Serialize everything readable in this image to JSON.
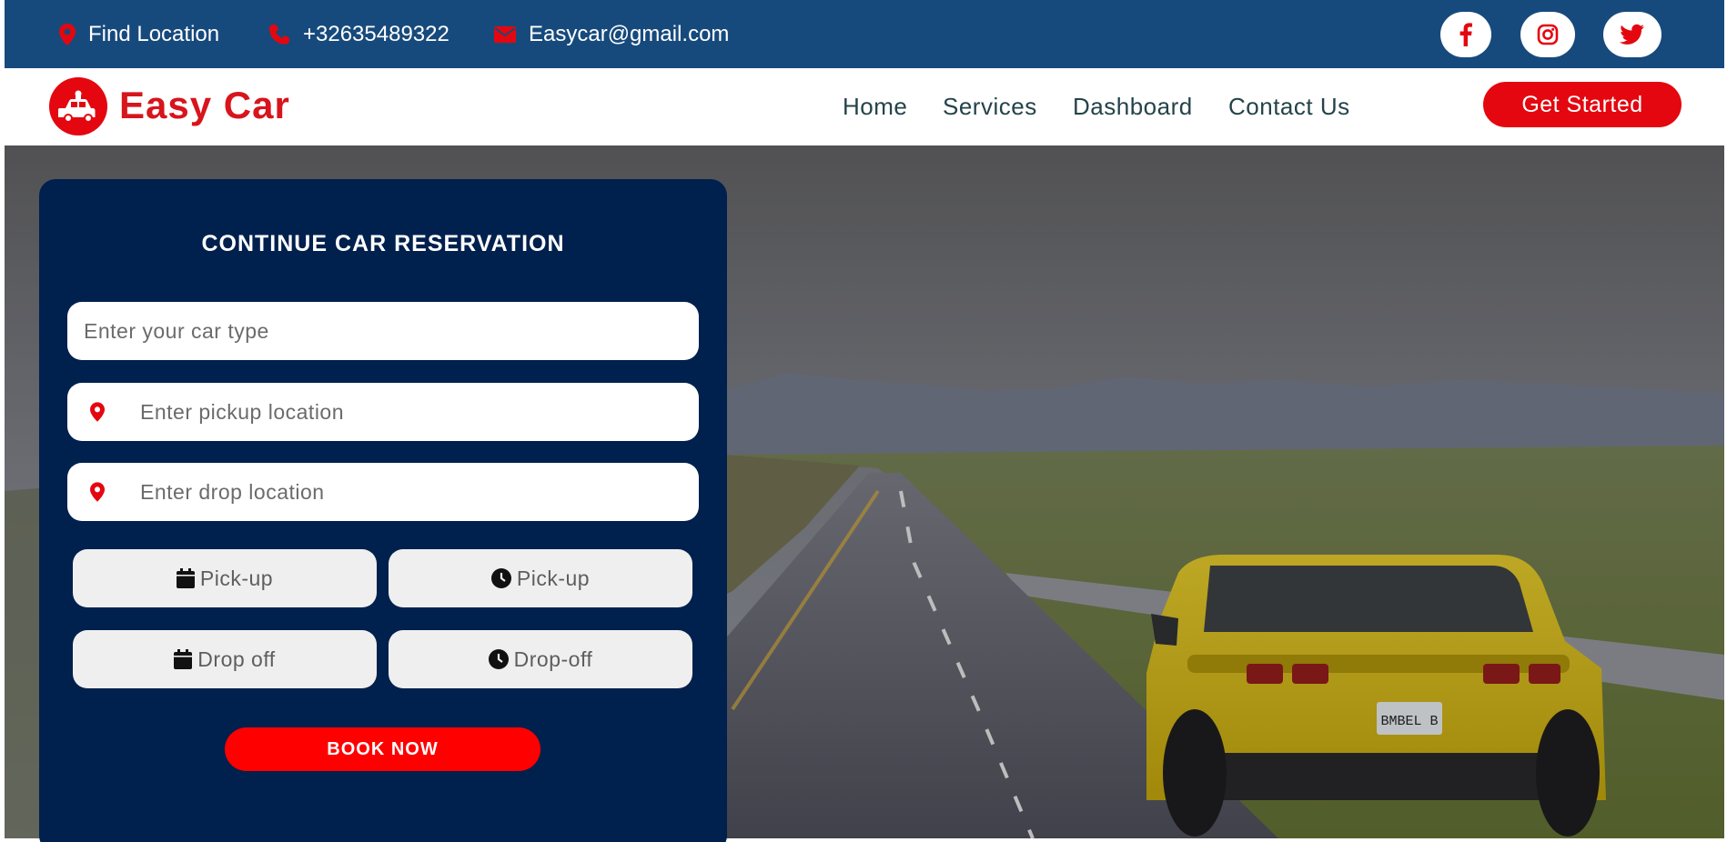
{
  "topbar": {
    "location_label": "Find Location",
    "phone": "+32635489322",
    "email": "Easycar@gmail.com",
    "icons": [
      "map-pin-icon",
      "phone-icon",
      "envelope-icon"
    ],
    "social": [
      "facebook-icon",
      "instagram-icon",
      "twitter-icon"
    ]
  },
  "nav": {
    "brand": "Easy Car",
    "links": [
      "Home",
      "Services",
      "Dashboard",
      "Contact Us"
    ],
    "cta": "Get Started"
  },
  "reservation": {
    "title": "CONTINUE CAR RESERVATION",
    "car_type_placeholder": "Enter your car type",
    "pickup_placeholder": "Enter pickup location",
    "drop_placeholder": "Enter drop location",
    "pickup_date_label": "Pick-up",
    "pickup_time_label": "Pick-up",
    "dropoff_date_label": "Drop off",
    "dropoff_time_label": "Drop-off",
    "submit_label": "BOOK NOW"
  },
  "hero": {
    "license_plate": "BMBEL B"
  },
  "colors": {
    "topbar_bg": "#174a7c",
    "accent_red": "#e4070f",
    "card_bg": "#00204d",
    "nav_text": "#24434a"
  }
}
